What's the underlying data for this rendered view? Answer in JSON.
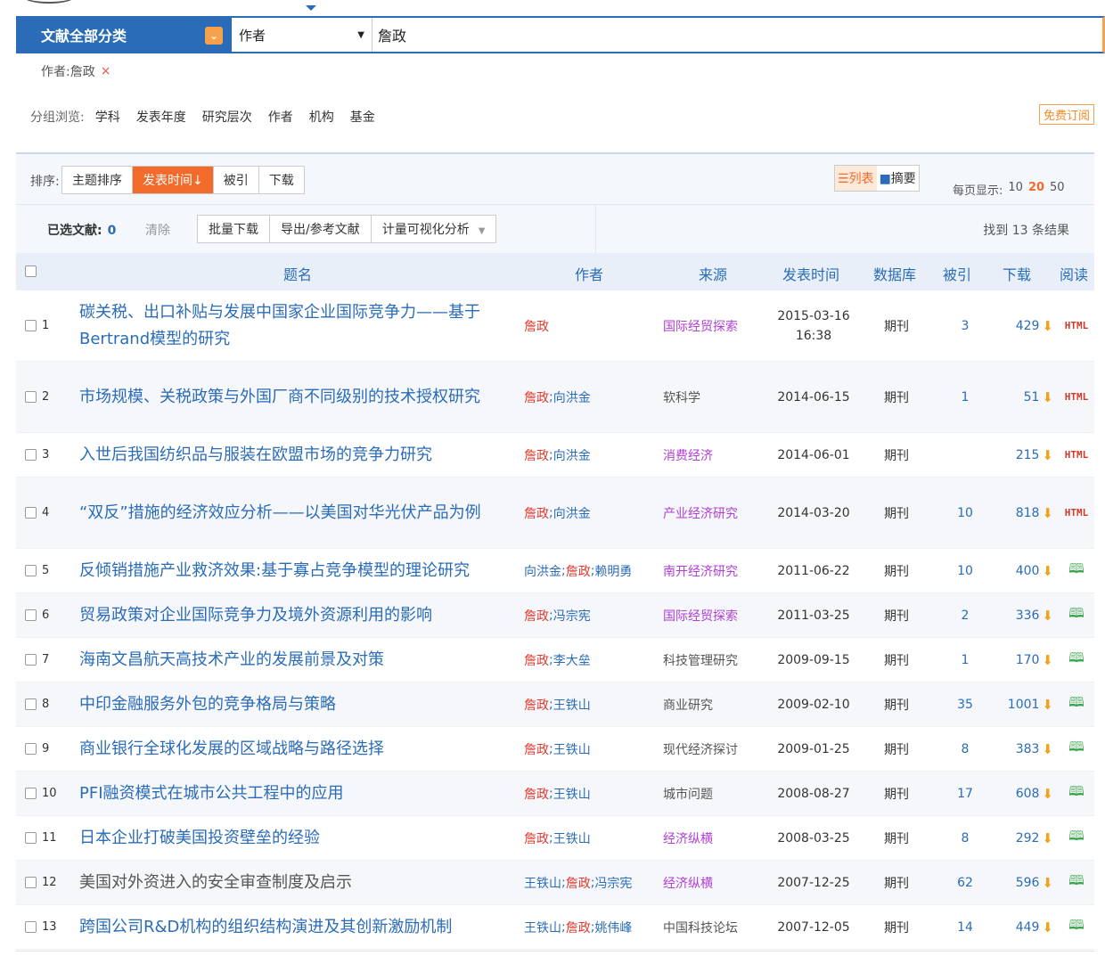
{
  "search": {
    "category": "文献全部分类",
    "field": "作者",
    "query": "詹政"
  },
  "filter": {
    "crumb": "作者:詹政",
    "remove": "×"
  },
  "groups": {
    "label": "分组浏览:",
    "items": [
      "学科",
      "发表年度",
      "研究层次",
      "作者",
      "机构",
      "基金"
    ],
    "subscribe": "免费订阅"
  },
  "sort": {
    "label": "排序:",
    "options": [
      "主题排序",
      "发表时间",
      "被引",
      "下载"
    ],
    "active_arrow": "↓",
    "view_list": "列表",
    "view_abstract": "摘要",
    "perpage_label": "每页显示:",
    "perpage_options": [
      "10",
      "20",
      "50"
    ],
    "perpage_selected": "20"
  },
  "actions": {
    "selected_label": "已选文献:",
    "selected_count": "0",
    "clear": "清除",
    "buttons": [
      "批量下载",
      "导出/参考文献",
      "计量可视化分析"
    ],
    "found": "找到 13 条结果"
  },
  "table": {
    "headers": {
      "title": "题名",
      "author": "作者",
      "source": "来源",
      "date": "发表时间",
      "db": "数据库",
      "cite": "被引",
      "download": "下载",
      "read": "阅读"
    },
    "rows": [
      {
        "n": "1",
        "title": "碳关税、出口补贴与发展中国家企业国际竞争力——基于Bertrand模型的研究",
        "authors": [
          {
            "name": "詹政",
            "hl": true
          }
        ],
        "source": "国际经贸探索",
        "src_link": true,
        "date": "2015-03-16",
        "time": "16:38",
        "db": "期刊",
        "cite": "3",
        "dl": "429",
        "read": "HTML"
      },
      {
        "n": "2",
        "title": "市场规模、关税政策与外国厂商不同级别的技术授权研究",
        "authors": [
          {
            "name": "詹政",
            "hl": true
          },
          {
            "name": "向洪金",
            "hl": false
          }
        ],
        "source": "软科学",
        "src_link": false,
        "date": "2014-06-15",
        "time": "",
        "db": "期刊",
        "cite": "1",
        "dl": "51",
        "read": "HTML"
      },
      {
        "n": "3",
        "title": "入世后我国纺织品与服装在欧盟市场的竞争力研究",
        "authors": [
          {
            "name": "詹政",
            "hl": true
          },
          {
            "name": "向洪金",
            "hl": false
          }
        ],
        "source": "消费经济",
        "src_link": true,
        "date": "2014-06-01",
        "time": "",
        "db": "期刊",
        "cite": "",
        "dl": "215",
        "read": "HTML"
      },
      {
        "n": "4",
        "title": "“双反”措施的经济效应分析——以美国对华光伏产品为例",
        "authors": [
          {
            "name": "詹政",
            "hl": true
          },
          {
            "name": "向洪金",
            "hl": false
          }
        ],
        "source": "产业经济研究",
        "src_link": true,
        "date": "2014-03-20",
        "time": "",
        "db": "期刊",
        "cite": "10",
        "dl": "818",
        "read": "HTML"
      },
      {
        "n": "5",
        "title": "反倾销措施产业救济效果:基于寡占竞争模型的理论研究",
        "authors": [
          {
            "name": "向洪金",
            "hl": false
          },
          {
            "name": "詹政",
            "hl": true
          },
          {
            "name": "赖明勇",
            "hl": false
          }
        ],
        "source": "南开经济研究",
        "src_link": true,
        "date": "2011-06-22",
        "time": "",
        "db": "期刊",
        "cite": "10",
        "dl": "400",
        "read": "book"
      },
      {
        "n": "6",
        "title": "贸易政策对企业国际竞争力及境外资源利用的影响",
        "authors": [
          {
            "name": "詹政",
            "hl": true
          },
          {
            "name": "冯宗宪",
            "hl": false
          }
        ],
        "source": "国际经贸探索",
        "src_link": true,
        "date": "2011-03-25",
        "time": "",
        "db": "期刊",
        "cite": "2",
        "dl": "336",
        "read": "book"
      },
      {
        "n": "7",
        "title": "海南文昌航天高技术产业的发展前景及对策",
        "authors": [
          {
            "name": "詹政",
            "hl": true
          },
          {
            "name": "李大垒",
            "hl": false
          }
        ],
        "source": "科技管理研究",
        "src_link": false,
        "date": "2009-09-15",
        "time": "",
        "db": "期刊",
        "cite": "1",
        "dl": "170",
        "read": "book"
      },
      {
        "n": "8",
        "title": "中印金融服务外包的竞争格局与策略",
        "authors": [
          {
            "name": "詹政",
            "hl": true
          },
          {
            "name": "王铁山",
            "hl": false
          }
        ],
        "source": "商业研究",
        "src_link": false,
        "date": "2009-02-10",
        "time": "",
        "db": "期刊",
        "cite": "35",
        "dl": "1001",
        "read": "book"
      },
      {
        "n": "9",
        "title": "商业银行全球化发展的区域战略与路径选择",
        "authors": [
          {
            "name": "詹政",
            "hl": true
          },
          {
            "name": "王铁山",
            "hl": false
          }
        ],
        "source": "现代经济探讨",
        "src_link": false,
        "date": "2009-01-25",
        "time": "",
        "db": "期刊",
        "cite": "8",
        "dl": "383",
        "read": "book"
      },
      {
        "n": "10",
        "title": "PFI融资模式在城市公共工程中的应用",
        "authors": [
          {
            "name": "詹政",
            "hl": true
          },
          {
            "name": "王铁山",
            "hl": false
          }
        ],
        "source": "城市问题",
        "src_link": false,
        "date": "2008-08-27",
        "time": "",
        "db": "期刊",
        "cite": "17",
        "dl": "608",
        "read": "book"
      },
      {
        "n": "11",
        "title": "日本企业打破美国投资壁垒的经验",
        "authors": [
          {
            "name": "詹政",
            "hl": true
          },
          {
            "name": "王铁山",
            "hl": false
          }
        ],
        "source": "经济纵横",
        "src_link": true,
        "date": "2008-03-25",
        "time": "",
        "db": "期刊",
        "cite": "8",
        "dl": "292",
        "read": "book"
      },
      {
        "n": "12",
        "title": "美国对外资进入的安全审查制度及启示",
        "authors": [
          {
            "name": "王铁山",
            "hl": false
          },
          {
            "name": "詹政",
            "hl": true
          },
          {
            "name": "冯宗宪",
            "hl": false
          }
        ],
        "source": "经济纵横",
        "src_link": true,
        "date": "2007-12-25",
        "time": "",
        "db": "期刊",
        "cite": "62",
        "dl": "596",
        "read": "book",
        "grey": true
      },
      {
        "n": "13",
        "title": "跨国公司R&D机构的组织结构演进及其创新激励机制",
        "authors": [
          {
            "name": "王铁山",
            "hl": false
          },
          {
            "name": "詹政",
            "hl": true
          },
          {
            "name": "姚伟峰",
            "hl": false
          }
        ],
        "source": "中国科技论坛",
        "src_link": false,
        "date": "2007-12-05",
        "time": "",
        "db": "期刊",
        "cite": "14",
        "dl": "449",
        "read": "book"
      }
    ]
  },
  "icons": {
    "download": "download-icon",
    "read_html": "html-icon",
    "read_book": "book-icon"
  }
}
